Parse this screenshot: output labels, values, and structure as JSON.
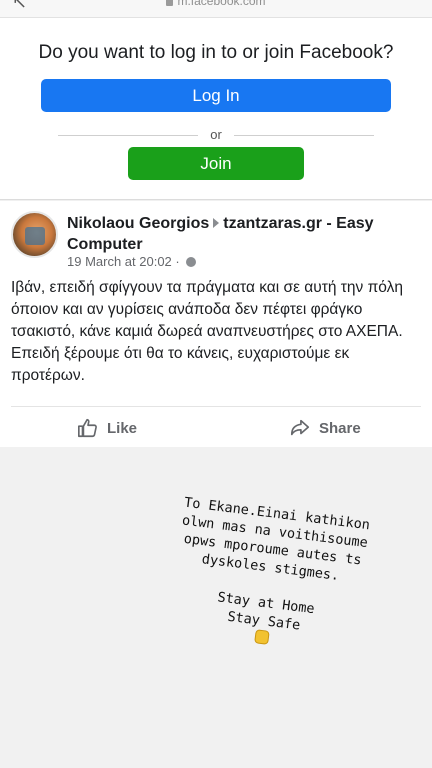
{
  "browser": {
    "url": "m.facebook.com"
  },
  "login_prompt": {
    "message": "Do you want to log in to or join Facebook?",
    "login_label": "Log In",
    "or_label": "or",
    "join_label": "Join"
  },
  "post": {
    "author": "Nikolaou Georgios",
    "target_page": "tzantzaras.gr - Easy Computer",
    "date": "19 March at 20:02 ·",
    "text": "Ιβάν, επειδή σφίγγουν τα πράγματα και σε αυτή την πόλη όποιον και αν γυρίσεις ανάποδα δεν πέφτει φράγκο τσακιστό, κάνε καμιά δωρεά αναπνευστήρες στο ΑΧΕΠΑ. Επειδή ξέρουμε ότι θα το κάνεις, ευχαριστούμε εκ προτέρων.",
    "like_label": "Like",
    "share_label": "Share"
  },
  "story": {
    "lines": [
      "To Ekane.Einai kathikon",
      "olwn mas na voithisoume",
      "opws mporoume autes ts",
      "dyskoles stigmes."
    ],
    "line_stay_home": "Stay at Home",
    "line_stay_safe": "Stay Safe"
  },
  "colors": {
    "login_button": "#1877f2",
    "join_button": "#1aa01a",
    "secondary_text": "#65676b"
  }
}
